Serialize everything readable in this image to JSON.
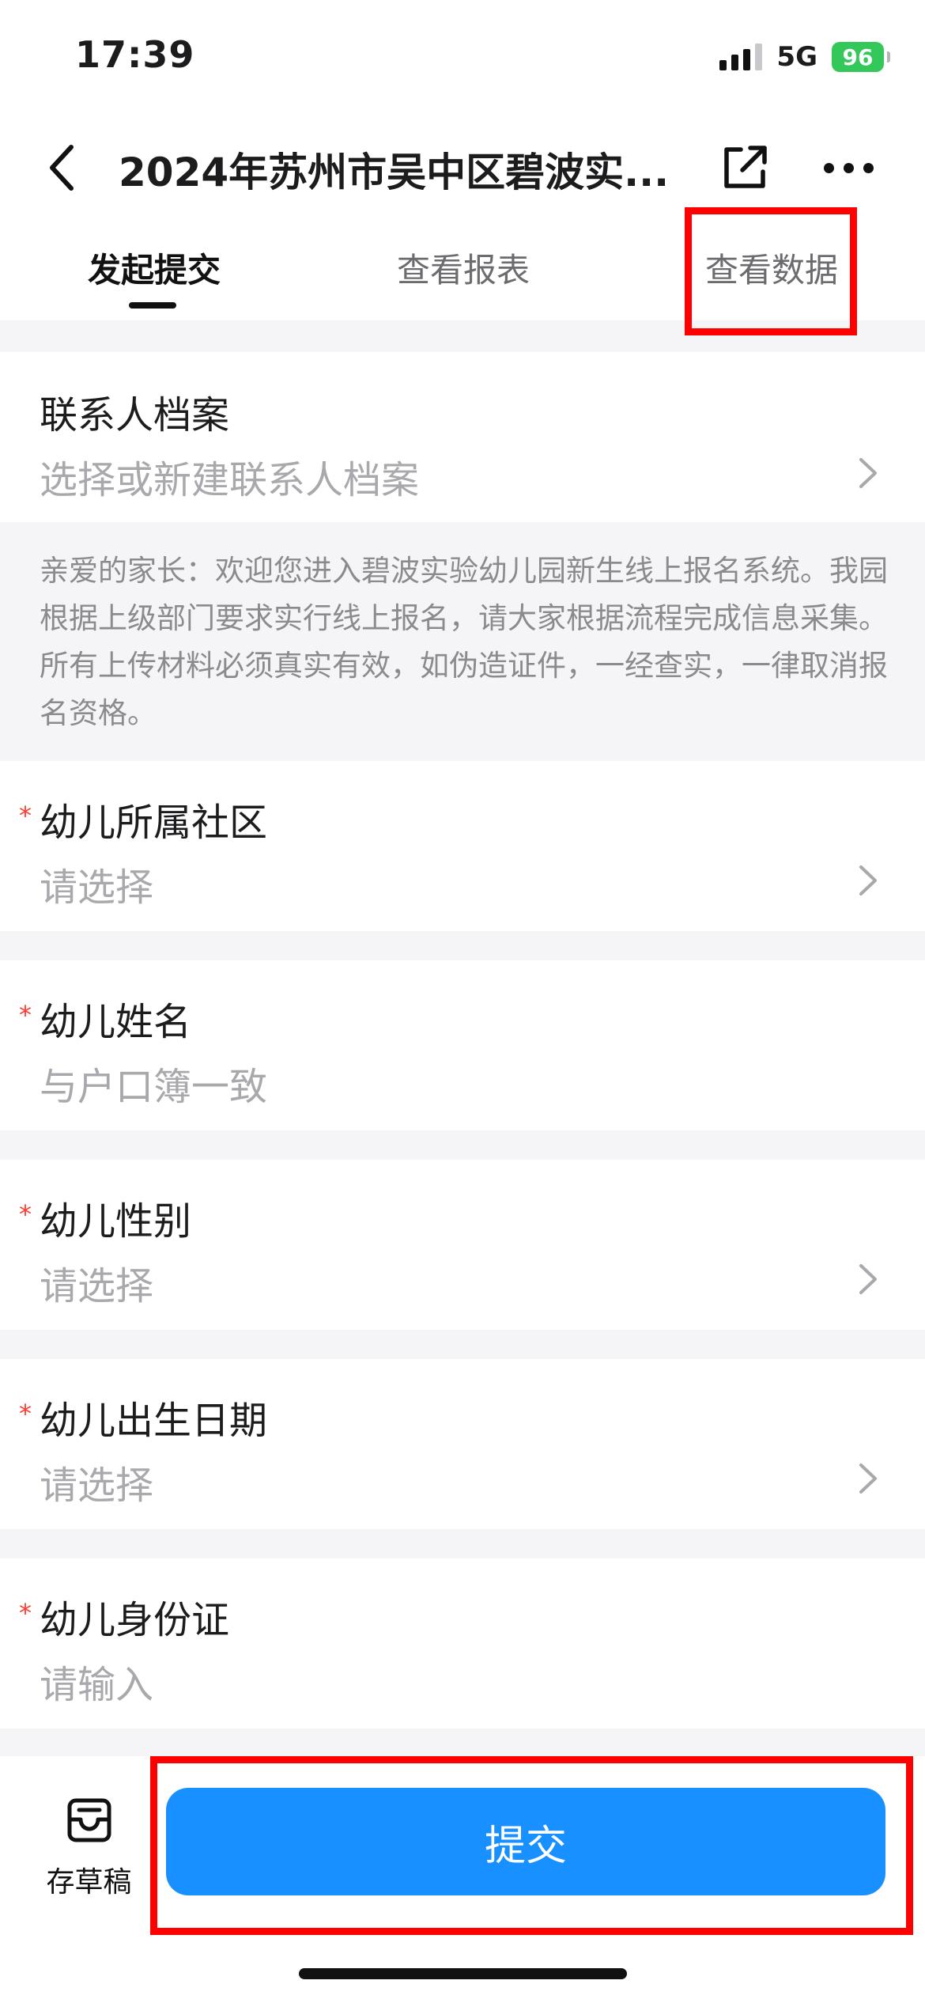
{
  "status": {
    "time": "17:39",
    "network": "5G",
    "battery": "96"
  },
  "nav": {
    "title": "2024年苏州市吴中区碧波实...",
    "icons": [
      "back-icon",
      "share-icon",
      "more-icon"
    ]
  },
  "tabs": [
    {
      "label": "发起提交",
      "active": true
    },
    {
      "label": "查看报表",
      "active": false
    },
    {
      "label": "查看数据",
      "active": false
    }
  ],
  "contact": {
    "label": "联系人档案",
    "placeholder": "选择或新建联系人档案"
  },
  "notice": "亲爱的家长：欢迎您进入碧波实验幼儿园新生线上报名系统。我园根据上级部门要求实行线上报名，请大家根据流程完成信息采集。所有上传材料必须真实有效，如伪造证件，一经查实，一律取消报名资格。",
  "fields": [
    {
      "label": "幼儿所属社区",
      "placeholder": "请选择",
      "required": true,
      "type": "select"
    },
    {
      "label": "幼儿姓名",
      "placeholder": "与户口簿一致",
      "required": true,
      "type": "input"
    },
    {
      "label": "幼儿性别",
      "placeholder": "请选择",
      "required": true,
      "type": "select"
    },
    {
      "label": "幼儿出生日期",
      "placeholder": "请选择",
      "required": true,
      "type": "select"
    },
    {
      "label": "幼儿身份证",
      "placeholder": "请输入",
      "required": true,
      "type": "input"
    }
  ],
  "required_mark": "*",
  "bottom": {
    "draft_label": "存草稿",
    "submit_label": "提交"
  },
  "colors": {
    "accent": "#1890ff",
    "highlight": "#ff0000",
    "required": "#ff3b30"
  }
}
